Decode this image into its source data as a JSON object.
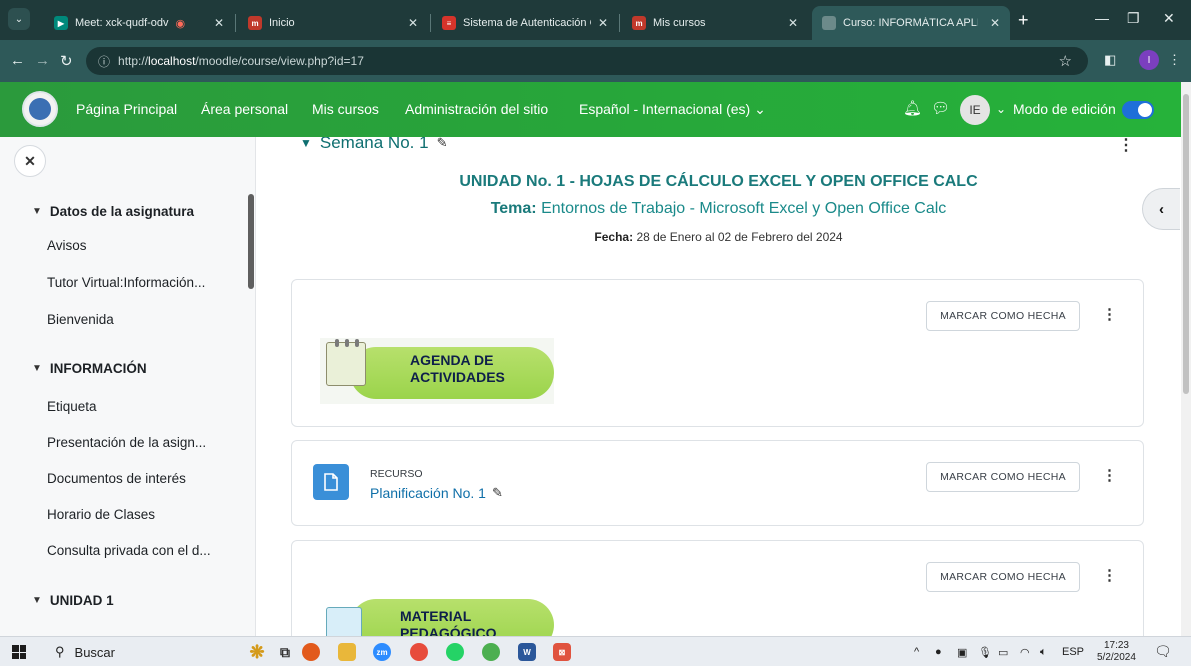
{
  "browser": {
    "tabs": [
      {
        "title": "Meet: xck-qudf-odv",
        "favicon": "meet-icon"
      },
      {
        "title": "Inicio",
        "favicon": "moodle-icon"
      },
      {
        "title": "Sistema de Autenticación Cc",
        "favicon": "auth-icon"
      },
      {
        "title": "Mis cursos",
        "favicon": "moodle-icon"
      },
      {
        "title": "Curso: INFORMÁTICA APLIC",
        "favicon": "moodle-icon"
      }
    ],
    "new_tab": "+",
    "url_prefix": "http://",
    "url_host": "localhost",
    "url_path": "/moodle/course/view.php?id=17",
    "profile_initial": "I"
  },
  "navbar": {
    "links": [
      "Página Principal",
      "Área personal",
      "Mis cursos",
      "Administración del sitio",
      "Español - Internacional (es) ⌄"
    ],
    "avatar_initials": "IE",
    "edit_mode_label": "Modo de edición",
    "edit_mode_on": true
  },
  "course_index": {
    "sections": [
      {
        "title": "Datos de la asignatura",
        "items": [
          "Avisos",
          "Tutor Virtual:Información...",
          "Bienvenida"
        ]
      },
      {
        "title": "INFORMACIÓN",
        "items": [
          "Etiqueta",
          "Presentación de la asign...",
          "Documentos de interés",
          "Horario de Clases",
          "Consulta privada con el d..."
        ]
      },
      {
        "title": "UNIDAD 1",
        "items": []
      }
    ]
  },
  "main": {
    "week_title": "Semana No. 1",
    "unit_title": "UNIDAD No. 1 - HOJAS DE CÁLCULO EXCEL Y OPEN OFFICE CALC",
    "theme_label": "Tema:",
    "theme_value": "Entornos de Trabajo - Microsoft Excel y Open Office Calc",
    "date_label": "Fecha:",
    "date_value": "28 de Enero al 02 de Febrero del 2024",
    "mark_done_label": "MARCAR COMO HECHA",
    "activities": [
      {
        "type": "label-image",
        "banner_text": "AGENDA DE ACTIVIDADES"
      },
      {
        "type": "resource",
        "type_label": "RECURSO",
        "name": "Planificación No. 1"
      },
      {
        "type": "label-image",
        "banner_text": "MATERIAL PEDAGÓGICO"
      }
    ]
  },
  "taskbar": {
    "search_placeholder": "Buscar",
    "tray_lang": "ESP",
    "time": "17:23",
    "date": "5/2/2024"
  }
}
